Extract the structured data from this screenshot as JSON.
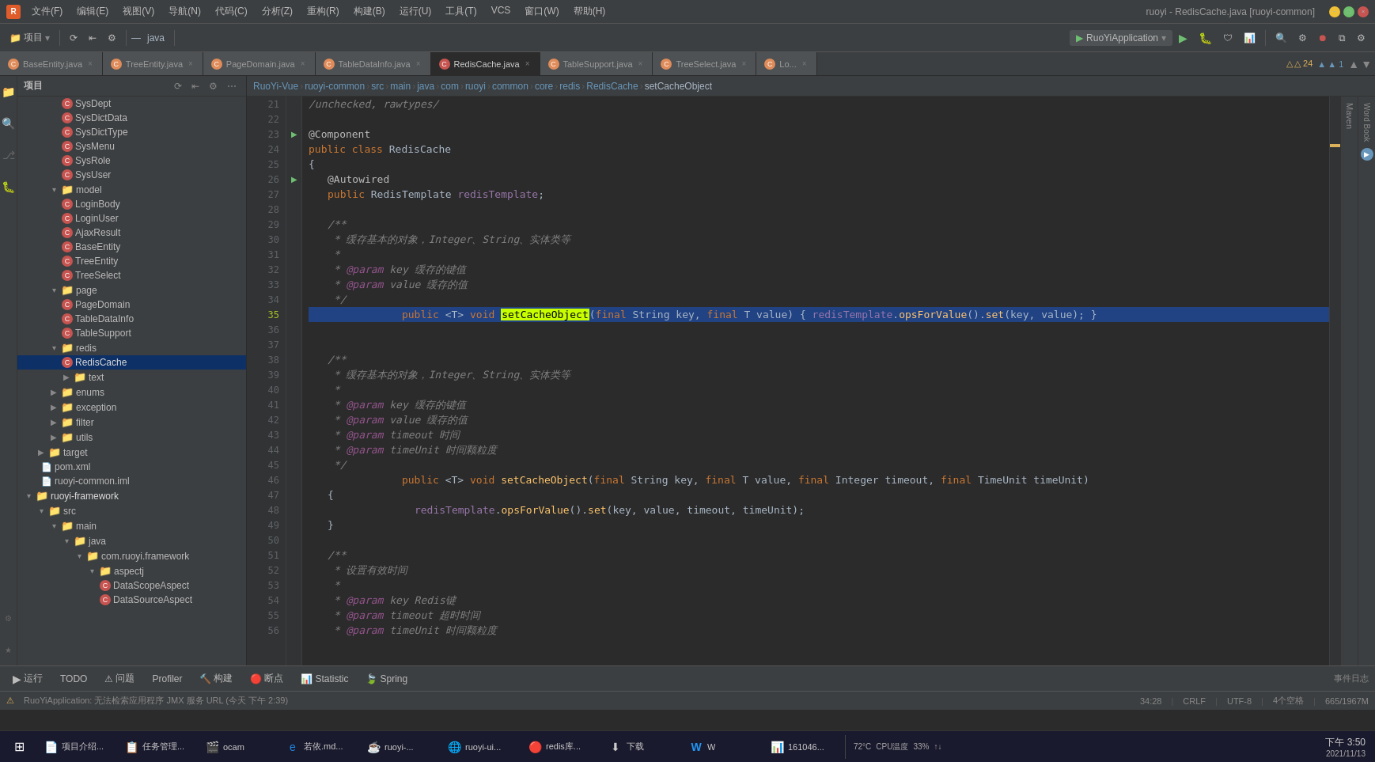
{
  "titlebar": {
    "logo": "R",
    "title": "ruoyi - RedisCache.java [ruoyi-common]",
    "menus": [
      "文件(F)",
      "编辑(E)",
      "视图(V)",
      "导航(N)",
      "代码(C)",
      "分析(Z)",
      "重构(R)",
      "构建(B)",
      "运行(U)",
      "工具(T)",
      "VCS",
      "窗口(W)",
      "帮助(H)"
    ]
  },
  "toolbar": {
    "project_label": "项目",
    "run_app": "RuoYiApplication",
    "run_icon": "▶",
    "debug_icon": "🐛"
  },
  "breadcrumb": {
    "items": [
      "RuoYi-Vue",
      "ruoyi-common",
      "src",
      "main",
      "java",
      "com",
      "ruoyi",
      "common",
      "core",
      "redis",
      "RedisCache",
      "setCacheObject"
    ]
  },
  "tabs": [
    {
      "label": "BaseEntity.java",
      "type": "orange",
      "modified": false
    },
    {
      "label": "TreeEntity.java",
      "type": "orange",
      "modified": false
    },
    {
      "label": "PageDomain.java",
      "type": "orange",
      "modified": false
    },
    {
      "label": "TableDataInfo.java",
      "type": "orange",
      "modified": false
    },
    {
      "label": "RedisCache.java",
      "type": "red",
      "active": true,
      "modified": false
    },
    {
      "label": "TableSupport.java",
      "type": "orange",
      "modified": false
    },
    {
      "label": "TreeSelect.java",
      "type": "orange",
      "modified": false
    },
    {
      "label": "Lo...",
      "type": "orange",
      "modified": false
    }
  ],
  "sidebar": {
    "header": "项目",
    "items": [
      {
        "label": "SysDept",
        "type": "class",
        "level": 4
      },
      {
        "label": "SysDictData",
        "type": "class",
        "level": 4
      },
      {
        "label": "SysDictType",
        "type": "class",
        "level": 4
      },
      {
        "label": "SysMenu",
        "type": "class",
        "level": 4
      },
      {
        "label": "SysRole",
        "type": "class",
        "level": 4
      },
      {
        "label": "SysUser",
        "type": "class",
        "level": 4
      },
      {
        "label": "model",
        "type": "folder",
        "level": 3,
        "expanded": true
      },
      {
        "label": "LoginBody",
        "type": "class",
        "level": 4
      },
      {
        "label": "LoginUser",
        "type": "class",
        "level": 4
      },
      {
        "label": "AjaxResult",
        "type": "class",
        "level": 4
      },
      {
        "label": "BaseEntity",
        "type": "class",
        "level": 4
      },
      {
        "label": "TreeEntity",
        "type": "class",
        "level": 4
      },
      {
        "label": "TreeSelect",
        "type": "class",
        "level": 4
      },
      {
        "label": "page",
        "type": "folder",
        "level": 3,
        "expanded": true
      },
      {
        "label": "PageDomain",
        "type": "class",
        "level": 4
      },
      {
        "label": "TableDataInfo",
        "type": "class",
        "level": 4
      },
      {
        "label": "TableSupport",
        "type": "class",
        "level": 4
      },
      {
        "label": "redis",
        "type": "folder",
        "level": 3,
        "expanded": true
      },
      {
        "label": "RedisCache",
        "type": "class",
        "level": 4,
        "selected": true
      },
      {
        "label": "text",
        "type": "folder",
        "level": 4,
        "expanded": false
      },
      {
        "label": "enums",
        "type": "folder",
        "level": 3,
        "expanded": false
      },
      {
        "label": "exception",
        "type": "folder",
        "level": 3,
        "expanded": false
      },
      {
        "label": "filter",
        "type": "folder",
        "level": 3,
        "expanded": false
      },
      {
        "label": "utils",
        "type": "folder",
        "level": 3,
        "expanded": false
      },
      {
        "label": "target",
        "type": "folder",
        "level": 2,
        "expanded": false
      },
      {
        "label": "pom.xml",
        "type": "file",
        "level": 2
      },
      {
        "label": "ruoyi-common.iml",
        "type": "file",
        "level": 2
      },
      {
        "label": "ruoyi-framework",
        "type": "folder",
        "level": 1,
        "expanded": true
      },
      {
        "label": "src",
        "type": "folder",
        "level": 2,
        "expanded": true
      },
      {
        "label": "main",
        "type": "folder",
        "level": 3,
        "expanded": true
      },
      {
        "label": "java",
        "type": "folder",
        "level": 4,
        "expanded": true
      },
      {
        "label": "com.ruoyi.framework",
        "type": "folder",
        "level": 5,
        "expanded": true
      },
      {
        "label": "aspectj",
        "type": "folder",
        "level": 6,
        "expanded": true
      },
      {
        "label": "DataScopeAspect",
        "type": "class",
        "level": 7
      },
      {
        "label": "DataSourceAspect",
        "type": "class",
        "level": 7
      }
    ]
  },
  "code": {
    "filename": "RedisCache.java",
    "lines": [
      {
        "num": 21,
        "content": "/unchecked, rawtypes/"
      },
      {
        "num": 22,
        "content": ""
      },
      {
        "num": 23,
        "content": "@Component",
        "has_indicator": true
      },
      {
        "num": 24,
        "content": "public class RedisCache"
      },
      {
        "num": 25,
        "content": "{"
      },
      {
        "num": 26,
        "content": "    @Autowired",
        "has_indicator": true
      },
      {
        "num": 27,
        "content": "    public RedisTemplate redisTemplate;"
      },
      {
        "num": 28,
        "content": ""
      },
      {
        "num": 29,
        "content": "    /**"
      },
      {
        "num": 30,
        "content": "     * 缓存基本的对象，Integer、String、实体类等"
      },
      {
        "num": 31,
        "content": "     *"
      },
      {
        "num": 32,
        "content": "     * @param key 缓存的键值"
      },
      {
        "num": 33,
        "content": "     * @param value 缓存的值"
      },
      {
        "num": 34,
        "content": "     */"
      },
      {
        "num": 35,
        "content": "    public <T> void setCacheObject(final String key, final T value) { redisTemplate.opsForValue().set(key, value); }",
        "highlighted": true
      },
      {
        "num": 36,
        "content": ""
      },
      {
        "num": 37,
        "content": ""
      },
      {
        "num": 38,
        "content": "    /**"
      },
      {
        "num": 39,
        "content": "     * 缓存基本的对象，Integer、String、实体类等"
      },
      {
        "num": 40,
        "content": "     *"
      },
      {
        "num": 41,
        "content": "     * @param key 缓存的键值"
      },
      {
        "num": 42,
        "content": "     * @param value 缓存的值"
      },
      {
        "num": 43,
        "content": "     * @param timeout 时间"
      },
      {
        "num": 44,
        "content": "     * @param timeUnit 时间颗粒度"
      },
      {
        "num": 45,
        "content": "     */"
      },
      {
        "num": 46,
        "content": "    public <T> void setCacheObject(final String key, final T value, final Integer timeout, final TimeUnit timeUnit)"
      },
      {
        "num": 47,
        "content": "    {"
      },
      {
        "num": 48,
        "content": "        redisTemplate.opsForValue().set(key, value, timeout, timeUnit);"
      },
      {
        "num": 49,
        "content": "    }"
      },
      {
        "num": 50,
        "content": ""
      },
      {
        "num": 51,
        "content": "    /**"
      },
      {
        "num": 52,
        "content": "     * 设置有效时间"
      },
      {
        "num": 53,
        "content": "     *"
      },
      {
        "num": 54,
        "content": "     * @param key Redis键"
      },
      {
        "num": 55,
        "content": "     * @param timeout 超时时间"
      },
      {
        "num": 56,
        "content": "     * @param timeUnit 时间颗粒度"
      }
    ]
  },
  "status": {
    "position": "34:28",
    "line_separator": "CRLF",
    "encoding": "UTF-8",
    "indent": "4个空格",
    "warnings": "△ 24",
    "info": "▲ 1",
    "event_log": "事件日志",
    "lines_count": "665/1967M"
  },
  "bottom_toolbar": {
    "buttons": [
      {
        "label": "运行",
        "icon": "▶"
      },
      {
        "label": "TODO"
      },
      {
        "label": "问题",
        "icon": "⚠"
      },
      {
        "label": "Profiler"
      },
      {
        "label": "构建"
      },
      {
        "label": "断点"
      },
      {
        "label": "Statistic"
      },
      {
        "label": "Spring"
      }
    ]
  },
  "notification": {
    "text": "RuoYiApplication: 无法检索应用程序 JMX 服务 URL (今天 下午 2:39)"
  },
  "taskbar": {
    "start_icon": "⊞",
    "apps": [
      {
        "label": "项目介绍...",
        "icon": "📄"
      },
      {
        "label": "任务管理...",
        "icon": "📋"
      },
      {
        "label": "ocam",
        "icon": "🎬"
      },
      {
        "label": "若依.md...",
        "icon": "📝"
      },
      {
        "label": "ruoyi-...",
        "icon": "☕"
      },
      {
        "label": "ruoyi-ui...",
        "icon": "🌐"
      },
      {
        "label": "redis库...",
        "icon": "🔴"
      },
      {
        "label": "下载",
        "icon": "⬇"
      },
      {
        "label": "W",
        "icon": "W"
      },
      {
        "label": "161046...",
        "icon": "📊"
      }
    ],
    "time": "下午 3:50",
    "date": "2021/11/13",
    "cpu_temp": "72°C",
    "cpu_label": "CPU温度",
    "mem": "33%",
    "network": "↑↓"
  },
  "right_panels": {
    "maven_label": "Maven",
    "word_book_label": "Word Book"
  }
}
